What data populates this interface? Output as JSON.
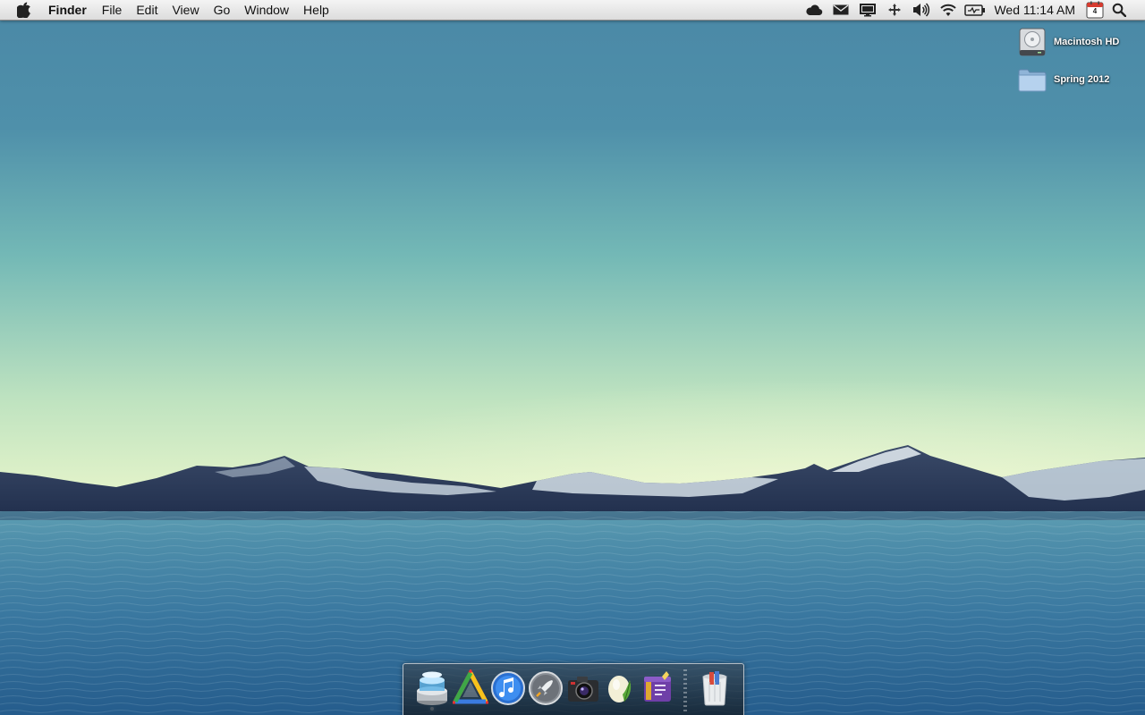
{
  "menubar": {
    "apple_icon": "apple-logo-icon",
    "app_name": "Finder",
    "menus": [
      "File",
      "Edit",
      "View",
      "Go",
      "Window",
      "Help"
    ],
    "status_icons": [
      "cloud-icon",
      "mail-icon",
      "display-icon",
      "network-icon",
      "volume-icon",
      "wifi-icon",
      "battery-icon"
    ],
    "clock": "Wed 11:14 AM",
    "calendar_day": "4",
    "spotlight_icon": "search-icon"
  },
  "desktop": {
    "icons": [
      {
        "label": "Macintosh HD",
        "icon": "hard-drive-icon"
      },
      {
        "label": "Spring 2012",
        "icon": "folder-icon"
      }
    ]
  },
  "dock": {
    "apps": [
      {
        "icon": "stack-app-icon",
        "running": true
      },
      {
        "icon": "color-triangle-app-icon",
        "running": false
      },
      {
        "icon": "itunes-icon",
        "running": false
      },
      {
        "icon": "launchpad-rocket-icon",
        "running": false
      },
      {
        "icon": "camera-app-icon",
        "running": false
      },
      {
        "icon": "egg-leaf-app-icon",
        "running": false
      },
      {
        "icon": "purple-box-app-icon",
        "running": false
      }
    ],
    "trash_icon": "trash-icon"
  },
  "colors": {
    "sky_top": "#4a8aa8",
    "sky_horizon": "#e4f5c4",
    "water": "#2f6f97",
    "mountain": "#2e3d5c",
    "menubar": "#e8e8e8"
  }
}
